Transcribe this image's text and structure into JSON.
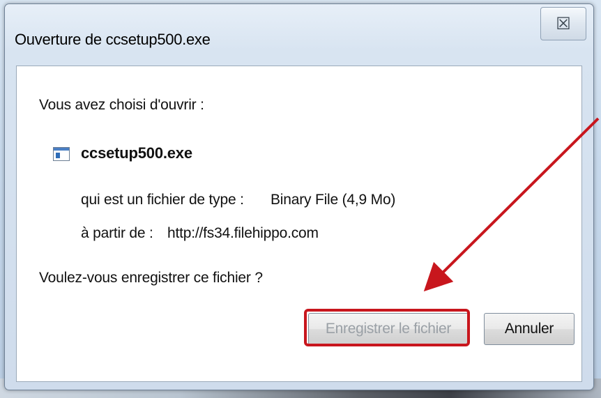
{
  "dialog": {
    "title": "Ouverture de ccsetup500.exe",
    "close_symbol": "☒",
    "intro": "Vous avez choisi d'ouvrir :",
    "file_name": "ccsetup500.exe",
    "file_type_label": "qui est un fichier de type :",
    "file_type_value": "Binary File (4,9 Mo)",
    "source_label": "à partir de :",
    "source_value": "http://fs34.filehippo.com",
    "question": "Voulez-vous enregistrer ce fichier ?",
    "save_label": "Enregistrer le fichier",
    "cancel_label": "Annuler"
  },
  "annotation": {
    "color": "#c8161d"
  },
  "icons": [
    "close-icon",
    "file-icon"
  ]
}
